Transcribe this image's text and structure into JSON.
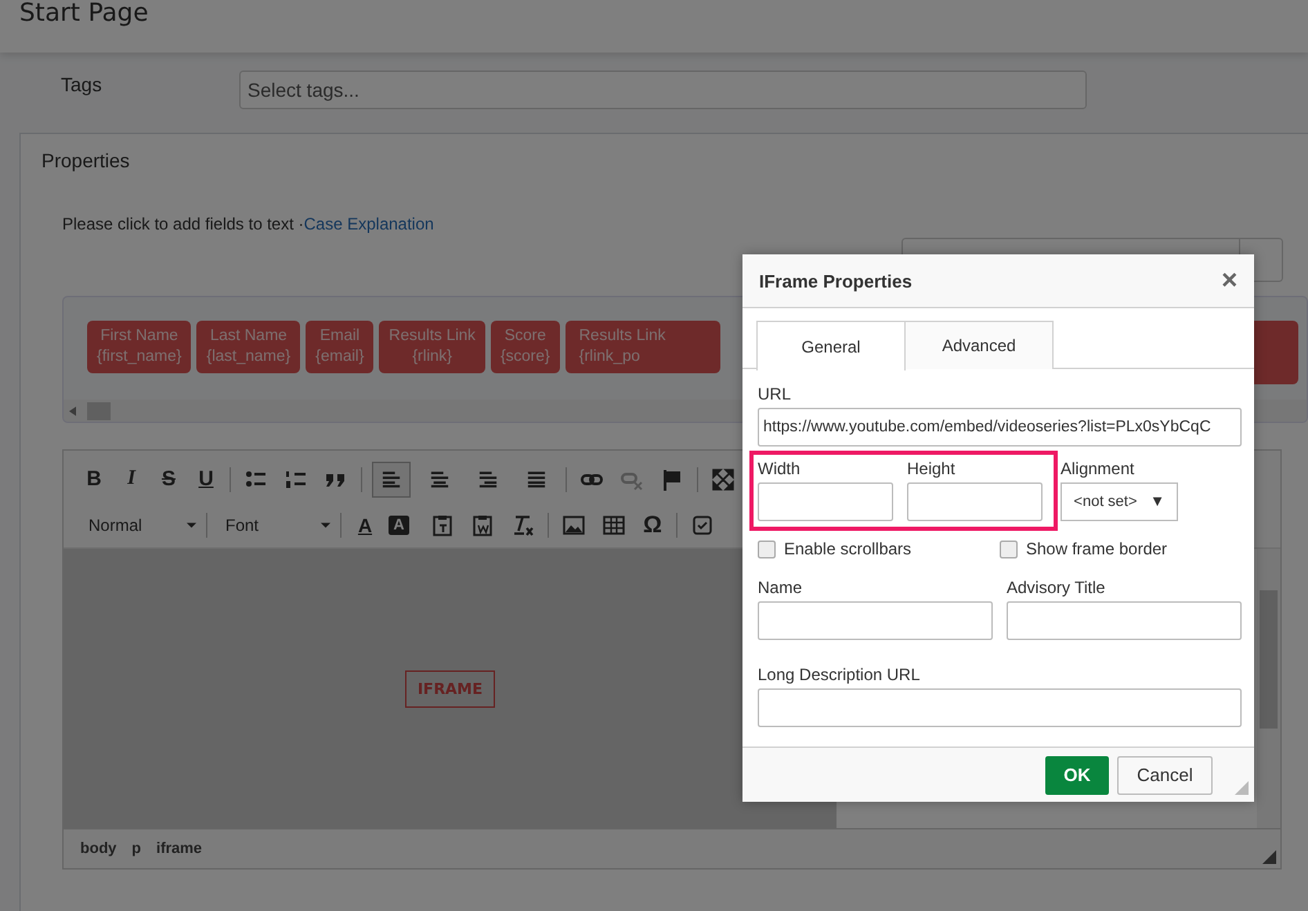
{
  "page": {
    "title": "Start Page"
  },
  "tags": {
    "label": "Tags",
    "placeholder": "Select tags..."
  },
  "properties": {
    "title": "Properties",
    "hint": "Please click to add fields to text ·",
    "link": "Case Explanation",
    "fields": [
      {
        "label": "First Name",
        "code": "{first_name}"
      },
      {
        "label": "Last Name",
        "code": "{last_name}"
      },
      {
        "label": "Email",
        "code": "{email}"
      },
      {
        "label": "Results Link",
        "code": "{rlink}"
      },
      {
        "label": "Score",
        "code": "{score}"
      },
      {
        "label": "Results Link",
        "code": "{rlink_po"
      }
    ]
  },
  "editor": {
    "format_buttons": [
      {
        "label": "B",
        "kind": "bold"
      },
      {
        "label": "I",
        "kind": "italic"
      },
      {
        "label": "S",
        "kind": "strike"
      },
      {
        "label": "U",
        "kind": "underline"
      }
    ],
    "align_buttons": [
      {
        "selected": true
      },
      {
        "selected": false
      },
      {
        "selected": false
      },
      {
        "selected": false
      }
    ],
    "style_select": "Normal",
    "font_select": "Font",
    "text_color": "A",
    "background_color": "A",
    "special_char": "Ω",
    "placeholder": "IFRAME",
    "path": [
      "body",
      "p",
      "iframe"
    ]
  },
  "dialog": {
    "title": "IFrame Properties",
    "close": "×",
    "tabs": [
      {
        "label": "General",
        "selected": true
      },
      {
        "label": "Advanced",
        "selected": false
      }
    ],
    "url": {
      "label": "URL",
      "value": "https://www.youtube.com/embed/videoseries?list=PLx0sYbCqC"
    },
    "width": {
      "label": "Width"
    },
    "height": {
      "label": "Height"
    },
    "alignment": {
      "label": "Alignment",
      "value": "<not set>",
      "arrow": "▼"
    },
    "checkboxes": [
      {
        "label": "Enable scrollbars",
        "checked": false
      },
      {
        "label": "Show frame border",
        "checked": false
      }
    ],
    "name": {
      "label": "Name"
    },
    "advisory_title": {
      "label": "Advisory Title"
    },
    "long_description": {
      "label": "Long Description URL"
    },
    "buttons": [
      {
        "label": "OK",
        "kind": "primary"
      },
      {
        "label": "Cancel",
        "kind": "default"
      }
    ]
  }
}
